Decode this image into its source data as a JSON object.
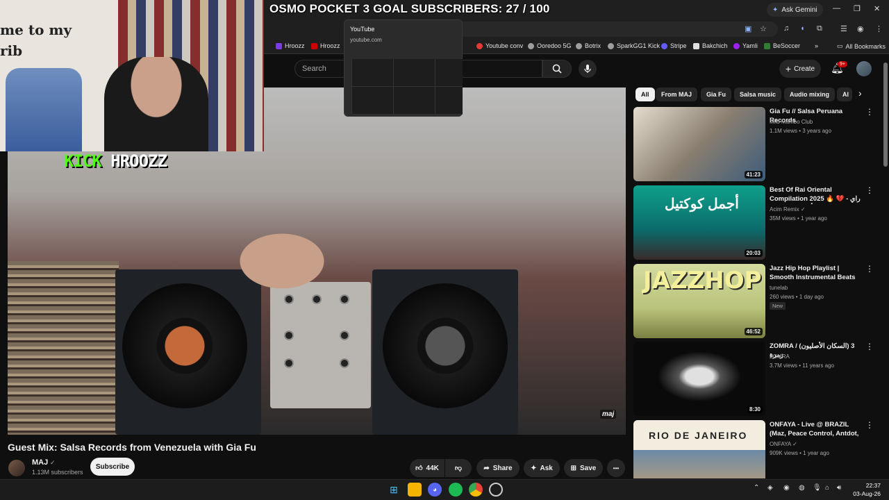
{
  "overlay": {
    "goal_text": "OSMO POCKET 3 GOAL SUBSCRIBERS: 27 / 100",
    "kick_word": "KICK",
    "kick_name": "HROOZZ",
    "webcam_sign": "me to my\nrib"
  },
  "browser": {
    "ask_gemini": "Ask Gemini",
    "tooltip_title": "YouTube",
    "tooltip_url": "youtube.com",
    "bookmarks": [
      {
        "label": "Hroozz",
        "color": "#7c3aed"
      },
      {
        "label": "Hroozz",
        "color": "#cc0000"
      },
      {
        "label": "Youtube conv",
        "color": "#e53935"
      },
      {
        "label": "Ooredoo 5G",
        "color": "#9e9e9e"
      },
      {
        "label": "Botrix",
        "color": "#9e9e9e"
      },
      {
        "label": "SparkGG1 Kick",
        "color": "#9e9e9e"
      },
      {
        "label": "Stripe",
        "color": "#635bff"
      },
      {
        "label": "Bakchich",
        "color": "#e0e0e0"
      },
      {
        "label": "Yamli",
        "color": "#a020f0"
      },
      {
        "label": "BeSoccer",
        "color": "#2e7d32"
      }
    ],
    "all_bookmarks": "All Bookmarks"
  },
  "youtube": {
    "search_placeholder": "Search",
    "create_label": "Create",
    "notif_badge": "9+",
    "video": {
      "title": "Guest Mix: Salsa Records from Venezuela with Gia Fu",
      "watermark": "maj",
      "channel": "MAJ",
      "verified": "✓",
      "subscribers": "1.13M subscribers",
      "subscribe": "Subscribe",
      "likes": "44K",
      "share": "Share",
      "ask": "Ask",
      "save": "Save",
      "more": "•••"
    },
    "chips": [
      "All",
      "From MAJ",
      "Gia Fu",
      "Salsa music",
      "Audio mixing",
      "Al"
    ],
    "recommendations": [
      {
        "title": "Gia Fu // Salsa Peruana Records",
        "channel": "Mild Mambo Club",
        "meta": "1.1M views • 3 years ago",
        "duration": "41:23",
        "verified": false,
        "badge": ""
      },
      {
        "title": "Best Of Rai Oriental Compilation 2025 🔥 راي - 💔 أجمل ريمكسات ...",
        "channel": "Acim Remix",
        "meta": "35M views • 1 year ago",
        "duration": "20:03",
        "verified": true,
        "badge": "",
        "thumb_text": "أجمل كوكتيل"
      },
      {
        "title": "Jazz Hip Hop Playlist | Smooth Instrumental Beats for Study, ...",
        "channel": "tunelab",
        "meta": "260 views • 1 day ago",
        "duration": "46:52",
        "verified": false,
        "badge": "New",
        "thumb_text": "JAZZHOP"
      },
      {
        "title": "ZOMRA / (السكان الأصليون) 3 زمرة",
        "channel": "ZOMRA",
        "meta": "3.7M views • 11 years ago",
        "duration": "8:30",
        "verified": false,
        "badge": ""
      },
      {
        "title": "ONFAYA - Live @ BRAZIL (Maz, Peace Control, Antdot, ...",
        "channel": "ONFAYA",
        "meta": "909K views • 1 year ago",
        "duration": "",
        "verified": true,
        "badge": "",
        "thumb_text": "RIO DE JANEIRO"
      }
    ]
  },
  "taskbar": {
    "time": "22:37",
    "date": "03-Aug-26"
  },
  "colors": {
    "kick_green": "#53fc18",
    "yt_red": "#cc0000",
    "bg": "#0f0f0f"
  }
}
